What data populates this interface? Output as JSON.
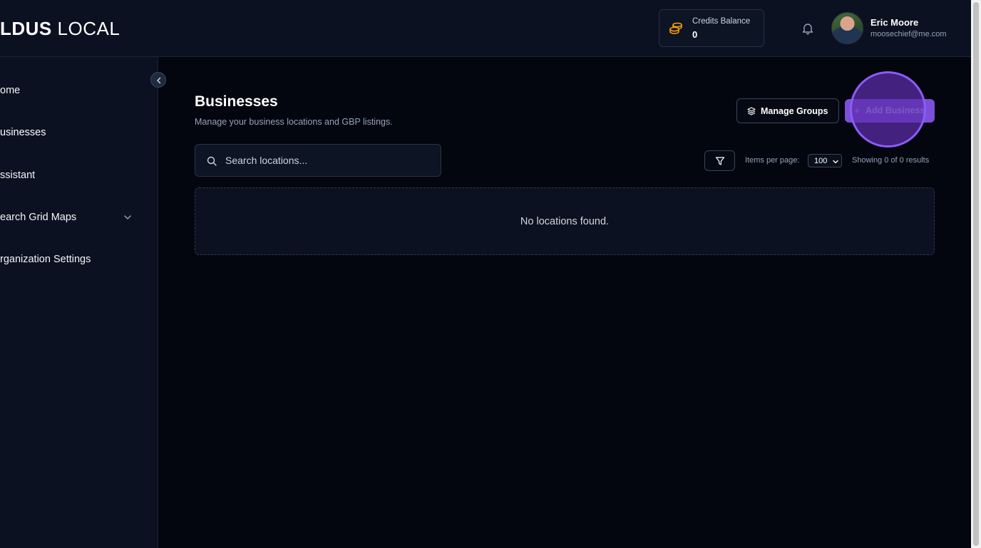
{
  "header": {
    "logo_bold": "LDUS",
    "logo_light": "LOCAL",
    "credits_label": "Credits Balance",
    "credits_value": "0",
    "user_name": "Eric Moore",
    "user_email": "moosechief@me.com"
  },
  "sidebar": {
    "items": [
      {
        "label": "ome"
      },
      {
        "label": "usinesses"
      },
      {
        "label": "ssistant"
      },
      {
        "label": "earch Grid Maps"
      },
      {
        "label": "rganization Settings"
      }
    ]
  },
  "main": {
    "title": "Businesses",
    "subtitle": "Manage your business locations and GBP listings.",
    "manage_groups_label": "Manage Groups",
    "add_business_label": "Add Business",
    "search_placeholder": "Search locations...",
    "items_per_page_label": "Items per page:",
    "items_per_page_value": "100",
    "results_text": "Showing 0 of 0 results",
    "empty_message": "No locations found."
  },
  "colors": {
    "accent": "#7c4fd8",
    "background": "#03050f",
    "panel": "#0b1120"
  }
}
